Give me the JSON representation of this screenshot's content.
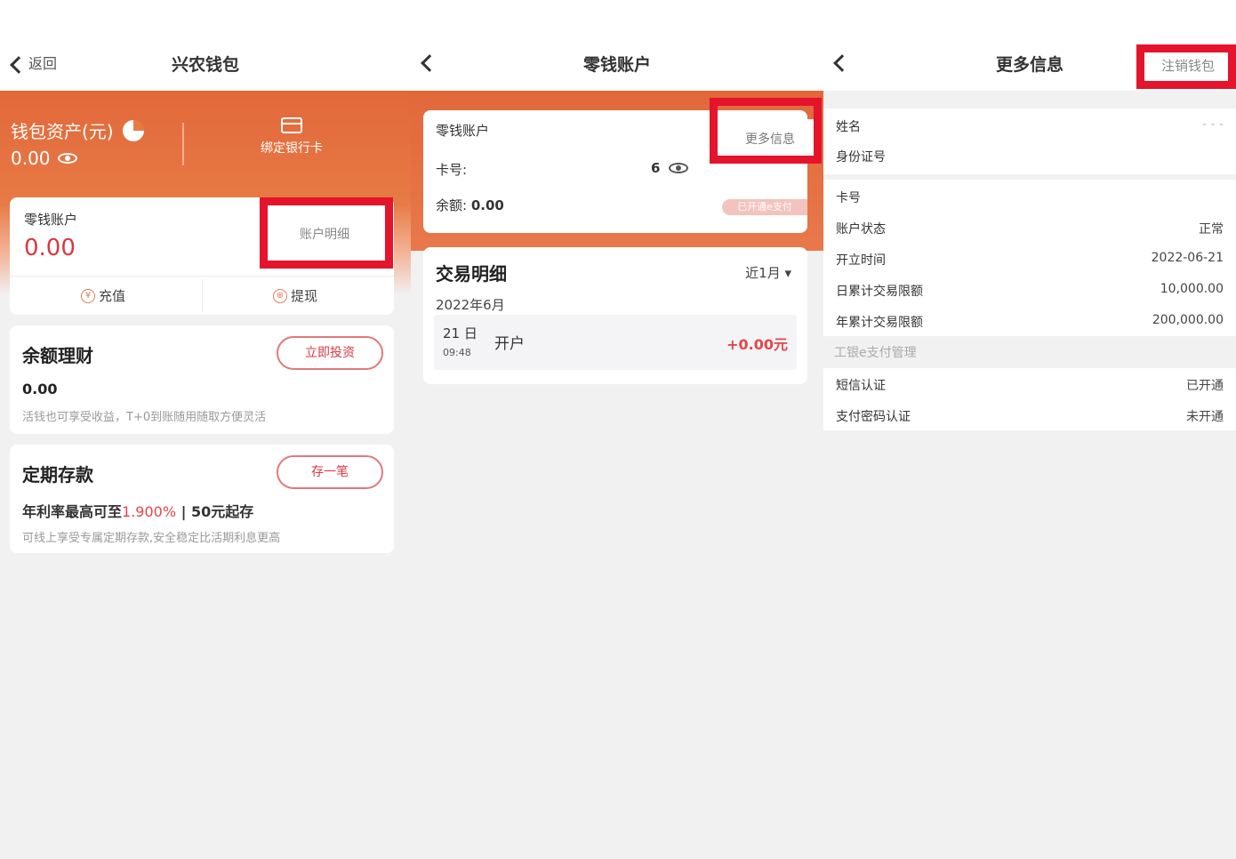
{
  "panel1": {
    "back_label": "返回",
    "title": "兴农钱包",
    "asset_label": "钱包资产(元)",
    "asset_value": "0.00",
    "bind_card_label": "绑定银行卡",
    "change_account": {
      "label": "零钱账户",
      "value": "0.00",
      "detail_button": "账户明细",
      "recharge": "充值",
      "withdraw": "提现"
    },
    "wealth": {
      "title": "余额理财",
      "button": "立即投资",
      "value": "0.00",
      "desc": "活钱也可享受收益，T+0到账随用随取方便灵活"
    },
    "deposit": {
      "title": "定期存款",
      "button": "存一笔",
      "rate_prefix": "年利率最高可至",
      "rate": "1.900%",
      "rate_suffix": " | 50元起存",
      "desc": "可线上享受专属定期存款,安全稳定比活期利息更高"
    }
  },
  "panel2": {
    "title": "零钱账户",
    "account_label": "零钱账户",
    "more_info_button": "更多信息",
    "card_label": "卡号:",
    "card_no_tail": "6",
    "balance_label": "余额:",
    "balance_value": "0.00",
    "epay_badge": "已开通e支付",
    "tx": {
      "title": "交易明细",
      "filter": "近1月 ▾",
      "month": "2022年6月",
      "day": "21 日",
      "time": "09:48",
      "desc": "开户",
      "amount": "+0.00元"
    }
  },
  "panel3": {
    "title": "更多信息",
    "cancel_button": "注销钱包",
    "group1": [
      {
        "k": "姓名",
        "v": "- - -"
      },
      {
        "k": "身份证号",
        "v": ""
      }
    ],
    "group2": [
      {
        "k": "卡号",
        "v": ""
      },
      {
        "k": "账户状态",
        "v": "正常"
      },
      {
        "k": "开立时间",
        "v": "2022-06-21"
      },
      {
        "k": "日累计交易限额",
        "v": "10,000.00"
      },
      {
        "k": "年累计交易限额",
        "v": "200,000.00"
      }
    ],
    "mgmt_header": "工银e支付管理",
    "group3": [
      {
        "k": "短信认证",
        "v": "已开通"
      },
      {
        "k": "支付密码认证",
        "v": "未开通"
      }
    ]
  },
  "colors": {
    "brand_orange": "#e2683a",
    "highlight_red": "#e5132b",
    "amount_red": "#d9383f"
  }
}
